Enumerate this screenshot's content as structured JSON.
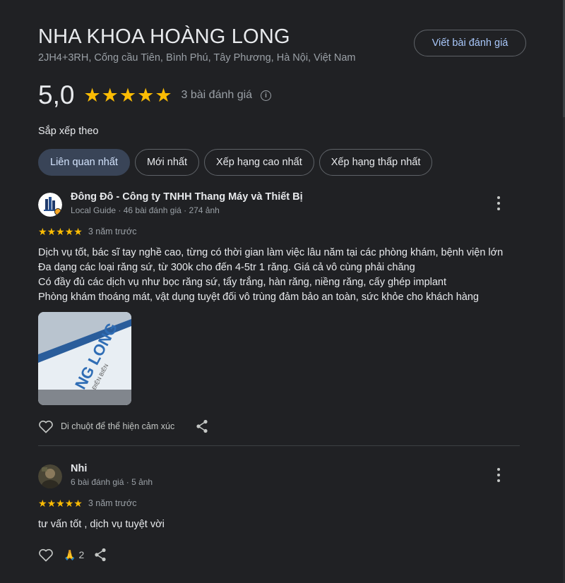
{
  "header": {
    "title": "NHA KHOA HOÀNG LONG",
    "address": "2JH4+3RH, Cống cầu Tiên, Bình Phú, Tây Phương, Hà Nội, Việt Nam",
    "write_review_label": "Viết bài đánh giá"
  },
  "summary": {
    "score": "5,0",
    "stars": 5,
    "review_count": "3 bài đánh giá",
    "info_icon": "info-icon"
  },
  "sort": {
    "label": "Sắp xếp theo",
    "options": [
      "Liên quan nhất",
      "Mới nhất",
      "Xếp hạng cao nhất",
      "Xếp hạng thấp nhất"
    ],
    "selected": "Liên quan nhất"
  },
  "reviews": [
    {
      "name": "Đông Đô - Công ty TNHH Thang Máy và Thiết Bị",
      "meta": "Local Guide · 46 bài đánh giá · 274 ảnh",
      "stars": 5,
      "time": "3 năm trước",
      "text": [
        "Dịch vụ tốt, bác sĩ tay nghề cao, từng có thời gian làm việc lâu năm tại các phòng khám, bệnh viện lớn",
        "Đa dạng các loại răng sứ, từ 300k cho đến 4-5tr 1 răng. Giá cả vô cùng phải chăng",
        "Có đầy đủ các dịch vụ như bọc răng sứ, tẩy trắng, hàn răng, niềng răng, cấy ghép implant",
        "Phòng khám thoáng mát, vật dụng tuyệt đối vô trùng đảm bảo an toàn, sức khỏe cho khách hàng"
      ],
      "reaction_hint": "Di chuột để thể hiện cảm xúc",
      "sign_text": "NG LONG",
      "sign_subtext": "ĐIỆN BIÊN"
    },
    {
      "name": "Nhi",
      "meta": "6 bài đánh giá · 5 ảnh",
      "stars": 5,
      "time": "3 năm trước",
      "text": [
        "tư vấn tốt , dịch vụ tuyệt vời"
      ],
      "reaction_count": "2"
    }
  ],
  "colors": {
    "background": "#202124",
    "star": "#fbbc04",
    "accent": "#a8c7fa",
    "active_chip": "#394457"
  }
}
